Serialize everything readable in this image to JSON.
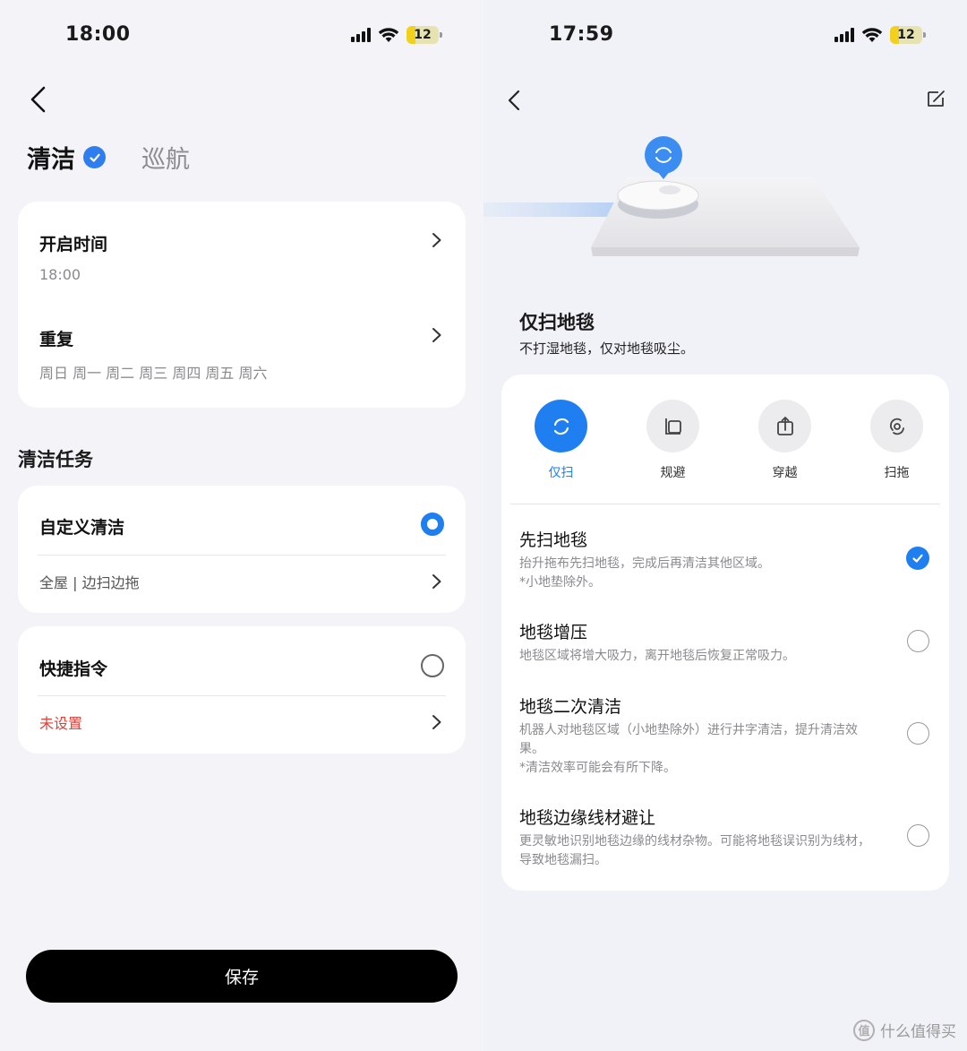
{
  "left": {
    "status": {
      "time": "18:00",
      "battery": "12"
    },
    "tabs": {
      "active": "清洁",
      "inactive": "巡航"
    },
    "schedule": {
      "start_label": "开启时间",
      "start_value": "18:00",
      "repeat_label": "重复",
      "repeat_value": "周日 周一 周二 周三 周四 周五 周六"
    },
    "section_title": "清洁任务",
    "custom_clean": {
      "label": "自定义清洁",
      "detail": "全屋 | 边扫边拖"
    },
    "shortcut": {
      "label": "快捷指令",
      "detail": "未设置"
    },
    "save_label": "保存"
  },
  "right": {
    "status": {
      "time": "17:59",
      "battery": "12"
    },
    "mode_title": "仅扫地毯",
    "mode_desc": "不打湿地毯，仅对地毯吸尘。",
    "modes": [
      {
        "label": "仅扫",
        "icon": "sweep-icon",
        "active": true
      },
      {
        "label": "规避",
        "icon": "avoid-icon",
        "active": false
      },
      {
        "label": "穿越",
        "icon": "cross-icon",
        "active": false
      },
      {
        "label": "扫拖",
        "icon": "sweep-mop-icon",
        "active": false
      }
    ],
    "options": [
      {
        "title": "先扫地毯",
        "desc": "抬升拖布先扫地毯，完成后再清洁其他区域。",
        "note": "*小地垫除外。",
        "checked": true
      },
      {
        "title": "地毯增压",
        "desc": "地毯区域将增大吸力，离开地毯后恢复正常吸力。",
        "note": "",
        "checked": false
      },
      {
        "title": "地毯二次清洁",
        "desc": "机器人对地毯区域（小地垫除外）进行井字清洁，提升清洁效果。",
        "note": " *清洁效率可能会有所下降。",
        "checked": false
      },
      {
        "title": "地毯边缘线材避让",
        "desc": "更灵敏地识别地毯边缘的线材杂物。可能将地毯误识别为线材，导致地毯漏扫。",
        "note": "",
        "checked": false
      }
    ],
    "watermark": "什么值得买"
  },
  "colors": {
    "accent": "#1f7ff0",
    "warning_text": "#e0403a"
  }
}
